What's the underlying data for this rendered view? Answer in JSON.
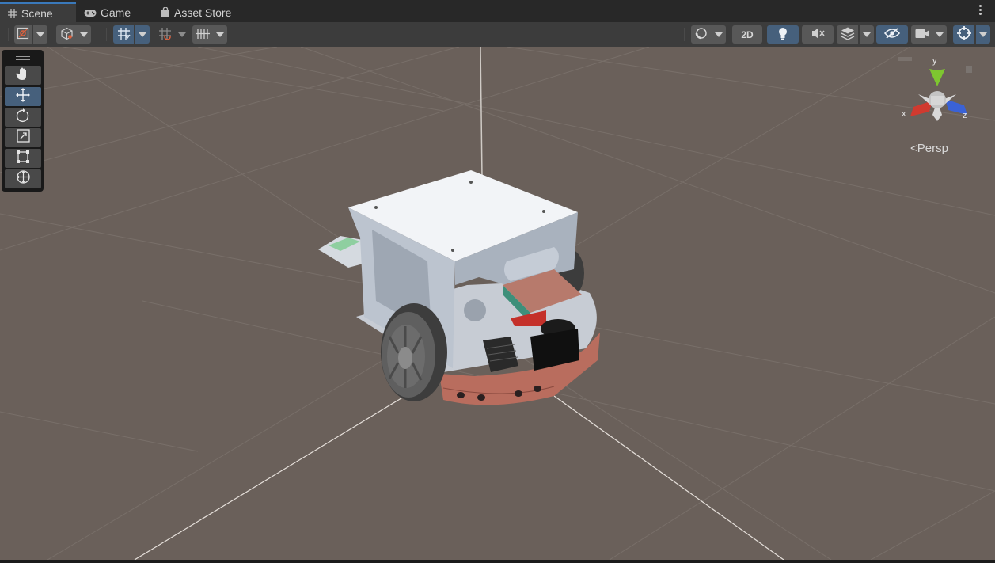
{
  "tabs": [
    {
      "label": "Scene",
      "icon": "grid-hash-icon",
      "active": true
    },
    {
      "label": "Game",
      "icon": "gamepad-icon",
      "active": false
    },
    {
      "label": "Asset Store",
      "icon": "shopping-bag-icon",
      "active": false
    }
  ],
  "toolbar": {
    "left": [
      "draw-mode-icon",
      "shading-mode-icon",
      "grid-snap-icon",
      "increment-snap-icon",
      "grid-visibility-icon"
    ],
    "right": {
      "effects": "orbit-effects-icon",
      "mode_2d_label": "2D",
      "lighting": "light-bulb-icon",
      "audio": "mute-audio-icon",
      "fx": "layers-fx-icon",
      "visibility": "hidden-eye-icon",
      "camera": "camera-icon",
      "gizmos": "gizmos-icon"
    }
  },
  "tools": [
    "hand-tool-icon",
    "move-tool-icon",
    "rotate-tool-icon",
    "scale-tool-icon",
    "rect-tool-icon",
    "transform-tool-icon"
  ],
  "active_tool": "move-tool-icon",
  "gizmo": {
    "y_label": "y",
    "x_label": "x",
    "z_label": "z",
    "projection_label": "Persp"
  },
  "colors": {
    "accent": "#46607c",
    "tab_highlight": "#3a79bb",
    "viewport": "#6a605a",
    "axis_x": "#d13a2f",
    "axis_y": "#7ec630",
    "axis_z": "#3a62d6"
  }
}
